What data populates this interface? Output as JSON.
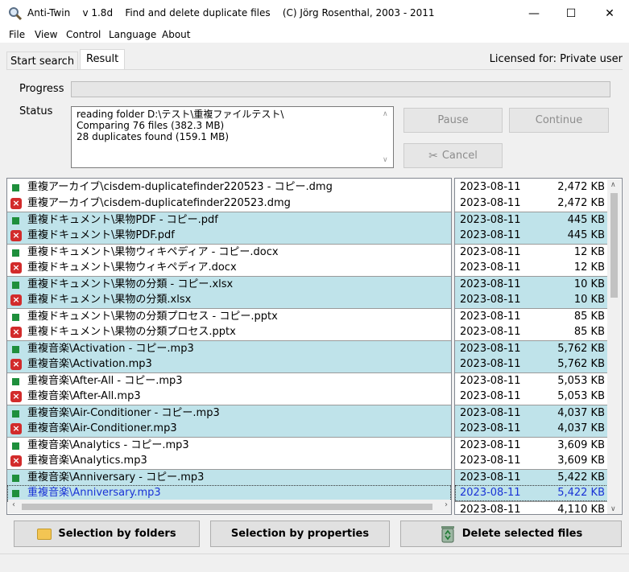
{
  "window": {
    "title": "Anti-Twin    v 1.8d    Find and delete duplicate files    (C) Jörg Rosenthal, 2003 - 2011",
    "minimize": "—",
    "maximize": "☐",
    "close": "✕"
  },
  "menu": [
    "File",
    "View",
    "Control",
    "Language",
    "About"
  ],
  "tabs": {
    "start": "Start search",
    "result": "Result"
  },
  "licensed": "Licensed for: Private user",
  "progress": {
    "label": "Progress",
    "value": 0
  },
  "status": {
    "label": "Status",
    "lines": [
      "reading folder D:\\テスト\\重複ファイルテスト\\",
      "Comparing 76 files (382.3 MB)",
      "28 duplicates found (159.1 MB)"
    ]
  },
  "controls": {
    "pause": "Pause",
    "continue": "Continue",
    "cancel": "Cancel"
  },
  "files": [
    {
      "name": "重複アーカイブ\\cisdem-duplicatefinder220523 - コピー.dmg",
      "date": "2023-08-11",
      "size": "2,472 KB",
      "action": "keep",
      "highlight": false,
      "selected": false
    },
    {
      "name": "重複アーカイブ\\cisdem-duplicatefinder220523.dmg",
      "date": "2023-08-11",
      "size": "2,472 KB",
      "action": "delete",
      "highlight": false,
      "selected": false
    },
    {
      "name": "重複ドキュメント\\果物PDF - コピー.pdf",
      "date": "2023-08-11",
      "size": "445 KB",
      "action": "keep",
      "highlight": true,
      "selected": false
    },
    {
      "name": "重複ドキュメント\\果物PDF.pdf",
      "date": "2023-08-11",
      "size": "445 KB",
      "action": "delete",
      "highlight": true,
      "selected": false
    },
    {
      "name": "重複ドキュメント\\果物ウィキペディア - コピー.docx",
      "date": "2023-08-11",
      "size": "12 KB",
      "action": "keep",
      "highlight": false,
      "selected": false
    },
    {
      "name": "重複ドキュメント\\果物ウィキペディア.docx",
      "date": "2023-08-11",
      "size": "12 KB",
      "action": "delete",
      "highlight": false,
      "selected": false
    },
    {
      "name": "重複ドキュメント\\果物の分類 - コピー.xlsx",
      "date": "2023-08-11",
      "size": "10 KB",
      "action": "keep",
      "highlight": true,
      "selected": false
    },
    {
      "name": "重複ドキュメント\\果物の分類.xlsx",
      "date": "2023-08-11",
      "size": "10 KB",
      "action": "delete",
      "highlight": true,
      "selected": false
    },
    {
      "name": "重複ドキュメント\\果物の分類プロセス - コピー.pptx",
      "date": "2023-08-11",
      "size": "85 KB",
      "action": "keep",
      "highlight": false,
      "selected": false
    },
    {
      "name": "重複ドキュメント\\果物の分類プロセス.pptx",
      "date": "2023-08-11",
      "size": "85 KB",
      "action": "delete",
      "highlight": false,
      "selected": false
    },
    {
      "name": "重複音楽\\Activation - コピー.mp3",
      "date": "2023-08-11",
      "size": "5,762 KB",
      "action": "keep",
      "highlight": true,
      "selected": false
    },
    {
      "name": "重複音楽\\Activation.mp3",
      "date": "2023-08-11",
      "size": "5,762 KB",
      "action": "delete",
      "highlight": true,
      "selected": false
    },
    {
      "name": "重複音楽\\After-All - コピー.mp3",
      "date": "2023-08-11",
      "size": "5,053 KB",
      "action": "keep",
      "highlight": false,
      "selected": false
    },
    {
      "name": "重複音楽\\After-All.mp3",
      "date": "2023-08-11",
      "size": "5,053 KB",
      "action": "delete",
      "highlight": false,
      "selected": false
    },
    {
      "name": "重複音楽\\Air-Conditioner - コピー.mp3",
      "date": "2023-08-11",
      "size": "4,037 KB",
      "action": "keep",
      "highlight": true,
      "selected": false
    },
    {
      "name": "重複音楽\\Air-Conditioner.mp3",
      "date": "2023-08-11",
      "size": "4,037 KB",
      "action": "delete",
      "highlight": true,
      "selected": false
    },
    {
      "name": "重複音楽\\Analytics - コピー.mp3",
      "date": "2023-08-11",
      "size": "3,609 KB",
      "action": "keep",
      "highlight": false,
      "selected": false
    },
    {
      "name": "重複音楽\\Analytics.mp3",
      "date": "2023-08-11",
      "size": "3,609 KB",
      "action": "delete",
      "highlight": false,
      "selected": false
    },
    {
      "name": "重複音楽\\Anniversary - コピー.mp3",
      "date": "2023-08-11",
      "size": "5,422 KB",
      "action": "keep",
      "highlight": true,
      "selected": false
    },
    {
      "name": "重複音楽\\Anniversary.mp3",
      "date": "2023-08-11",
      "size": "5,422 KB",
      "action": "keep",
      "highlight": true,
      "selected": true
    },
    {
      "name": "",
      "date": "2023-08-11",
      "size": "4,110 KB",
      "action": "",
      "highlight": false,
      "selected": false
    }
  ],
  "buttons": {
    "by_folders": "Selection by folders",
    "by_properties": "Selection by properties",
    "delete": "Delete selected files"
  },
  "icons": {
    "app": "magnifier-icon",
    "folder": "folder-icon",
    "recycle": "recycle-bin-icon",
    "cancel": "cancel-x-icon",
    "keep": "keep-square-icon",
    "delete": "delete-x-icon"
  },
  "colors": {
    "highlight": "#bfe3ea",
    "keep": "#1e8f3c",
    "delete": "#d22b2b",
    "selected_text": "#1a33d6"
  }
}
